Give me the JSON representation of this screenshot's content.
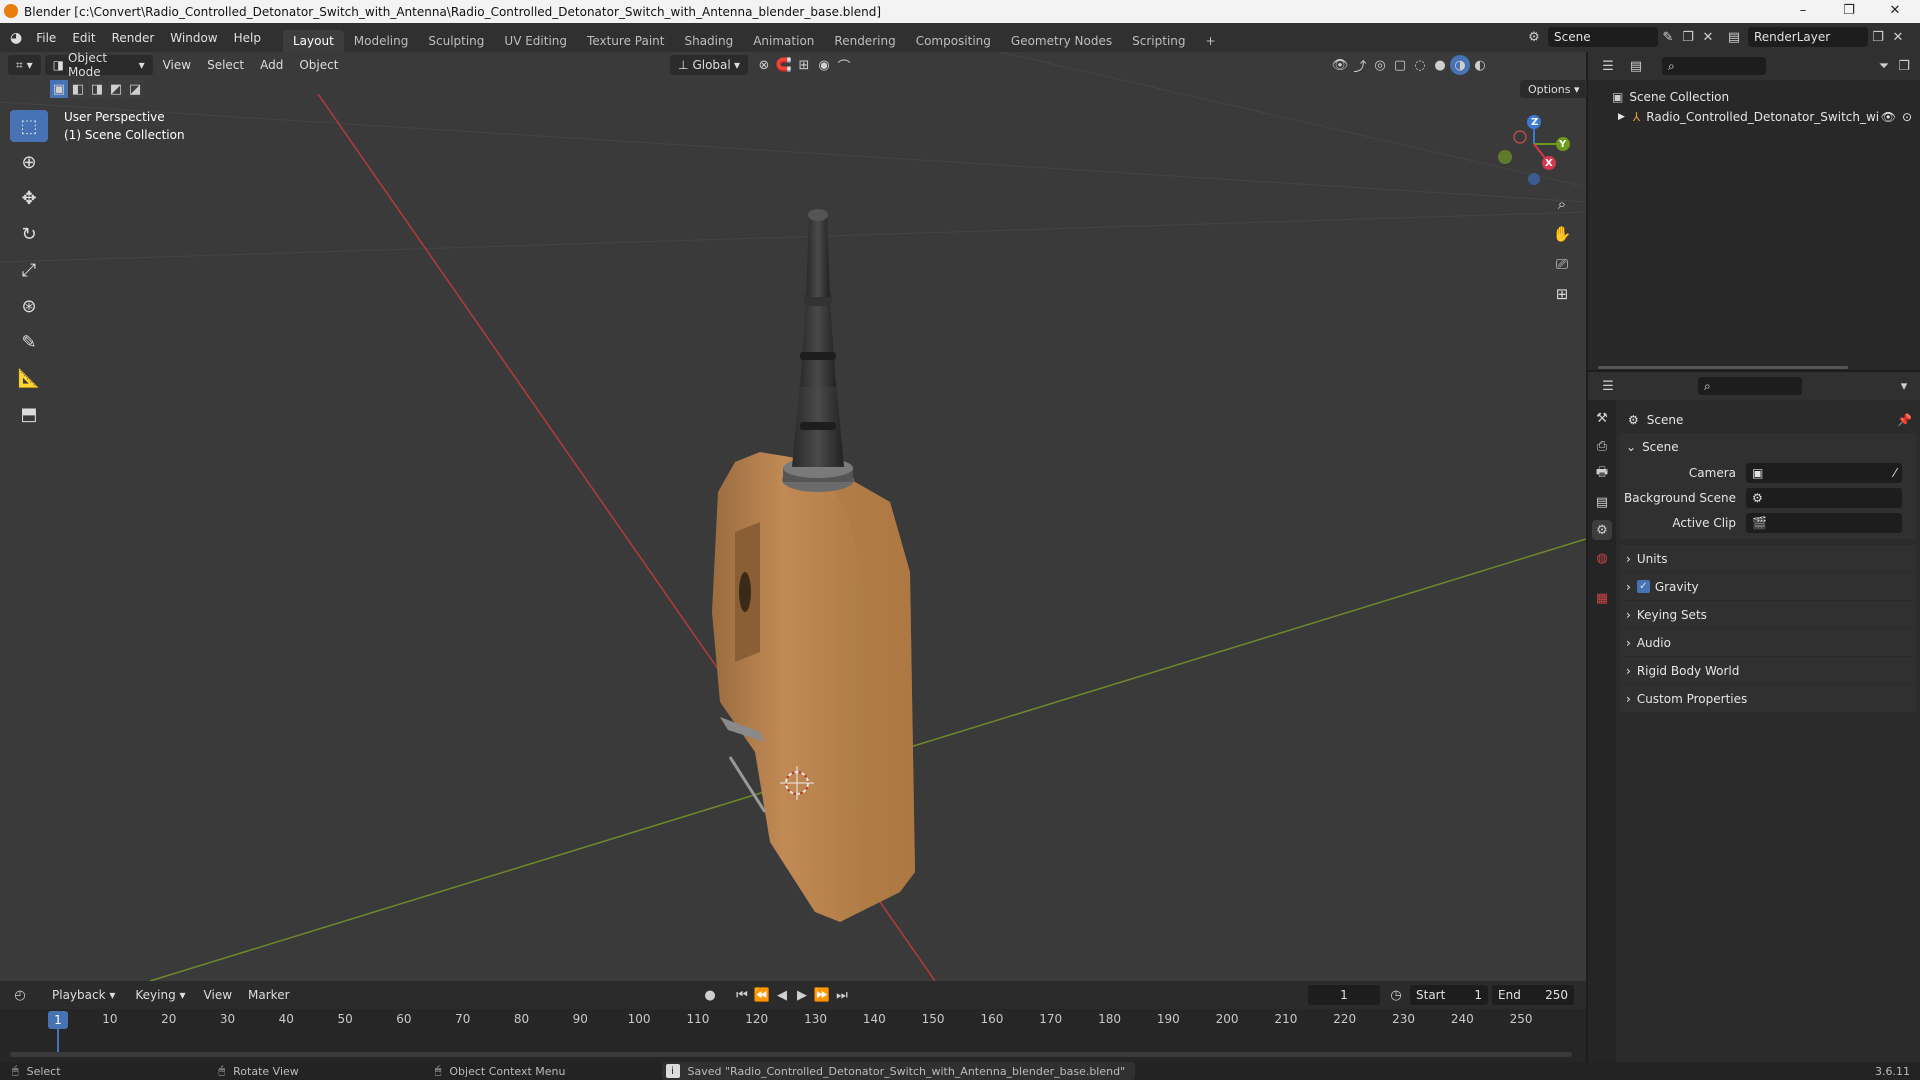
{
  "window": {
    "title": "Blender [c:\\Convert\\Radio_Controlled_Detonator_Switch_with_Antenna\\Radio_Controlled_Detonator_Switch_with_Antenna_blender_base.blend]",
    "min_glyph": "–",
    "max_glyph": "❐",
    "close_glyph": "✕"
  },
  "menu": [
    "File",
    "Edit",
    "Render",
    "Window",
    "Help"
  ],
  "workspaces": [
    "Layout",
    "Modeling",
    "Sculpting",
    "UV Editing",
    "Texture Paint",
    "Shading",
    "Animation",
    "Rendering",
    "Compositing",
    "Geometry Nodes",
    "Scripting"
  ],
  "active_workspace": "Layout",
  "add_workspace": "+",
  "scene_field": "Scene",
  "renderlayer_field": "RenderLayer",
  "viewport": {
    "mode": "Object Mode",
    "menus": [
      "View",
      "Select",
      "Add",
      "Object"
    ],
    "transform_orientation": "Global",
    "options_label": "Options",
    "perspective_label": "User Perspective",
    "collection_label": "(1) Scene Collection",
    "gizmo": {
      "x": "X",
      "y": "Y",
      "z": "Z"
    }
  },
  "outliner": {
    "root": "Scene Collection",
    "item": "Radio_Controlled_Detonator_Switch_wi"
  },
  "properties": {
    "context": "Scene",
    "panel": "Scene",
    "camera_label": "Camera",
    "background_scene_label": "Background Scene",
    "active_clip_label": "Active Clip",
    "panels": [
      "Units",
      "Gravity",
      "Keying Sets",
      "Audio",
      "Rigid Body World",
      "Custom Properties"
    ]
  },
  "timeline": {
    "menus": [
      "Playback",
      "Keying",
      "View",
      "Marker"
    ],
    "current_frame": "1",
    "start_label": "Start",
    "start_value": "1",
    "end_label": "End",
    "end_value": "250",
    "ticks": [
      "10",
      "20",
      "30",
      "40",
      "50",
      "60",
      "70",
      "80",
      "90",
      "100",
      "110",
      "120",
      "130",
      "140",
      "150",
      "160",
      "170",
      "180",
      "190",
      "200",
      "210",
      "220",
      "230",
      "240",
      "250"
    ],
    "playhead": "1"
  },
  "statusbar": {
    "select": "Select",
    "rotate": "Rotate View",
    "context_menu": "Object Context Menu",
    "message": "Saved \"Radio_Controlled_Detonator_Switch_with_Antenna_blender_base.blend\"",
    "version": "3.6.11"
  }
}
